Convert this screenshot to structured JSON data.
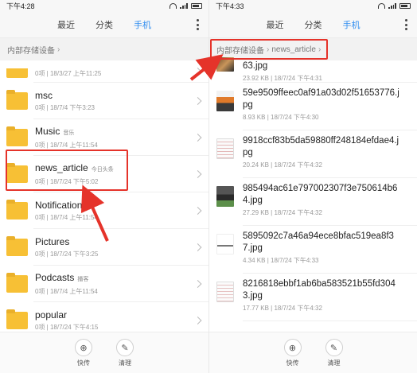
{
  "left": {
    "status": {
      "time": "下午4:28"
    },
    "tabs": [
      {
        "label": "最近",
        "active": false
      },
      {
        "label": "分类",
        "active": false
      },
      {
        "label": "手机",
        "active": true
      }
    ],
    "breadcrumb": [
      "内部存储设备"
    ],
    "partial_meta": "0项 | 18/3/27 上午11:25",
    "folders": [
      {
        "name": "msc",
        "tag": "",
        "meta": "0项 | 18/7/4 下午3:23"
      },
      {
        "name": "Music",
        "tag": "音乐",
        "meta": "0项 | 18/7/4 上午11:54"
      },
      {
        "name": "news_article",
        "tag": "今日头条",
        "meta": "0项 | 18/7/24 下午5:02"
      },
      {
        "name": "Notifications",
        "tag": "",
        "meta": "0项 | 18/7/4 上午11:54"
      },
      {
        "name": "Pictures",
        "tag": "",
        "meta": "0项 | 18/7/24 下午3:25"
      },
      {
        "name": "Podcasts",
        "tag": "播客",
        "meta": "0项 | 18/7/4 上午11:54"
      },
      {
        "name": "popular",
        "tag": "",
        "meta": "0项 | 18/7/24 下午4:15"
      }
    ],
    "bottom": {
      "share_label": "快传",
      "clean_label": "清理"
    }
  },
  "right": {
    "status": {
      "time": "下午4:33"
    },
    "tabs": [
      {
        "label": "最近",
        "active": false
      },
      {
        "label": "分类",
        "active": false
      },
      {
        "label": "手机",
        "active": true
      }
    ],
    "breadcrumb": [
      "内部存储设备",
      "news_article"
    ],
    "partial_file": {
      "name": "63.jpg",
      "meta": "23.92 KB | 18/7/24 下午4:31"
    },
    "files": [
      {
        "name": "59e9509ffeec0af91a03d02f51653776.jpg",
        "meta": "8.93 KB | 18/7/24 下午4:30",
        "thumb": "orange"
      },
      {
        "name": "9918ccf83b5da59880ff248184efdae4.jpg",
        "meta": "20.24 KB | 18/7/24 下午4:32",
        "thumb": "doc"
      },
      {
        "name": "985494ac61e797002307f3e750614b64.jpg",
        "meta": "27.29 KB | 18/7/24 下午4:32",
        "thumb": "dark"
      },
      {
        "name": "5895092c7a46a94ece8bfac519ea8f37.jpg",
        "meta": "4.34 KB | 18/7/24 下午4:33",
        "thumb": "text"
      },
      {
        "name": "8216818ebbf1ab6ba583521b55fd3043.jpg",
        "meta": "17.77 KB | 18/7/24 下午4:32",
        "thumb": "doc"
      }
    ],
    "bottom": {
      "share_label": "快传",
      "clean_label": "清理"
    }
  },
  "colors": {
    "accent": "#2f8df0",
    "highlight": "#e5332a",
    "folder": "#f7c035"
  }
}
